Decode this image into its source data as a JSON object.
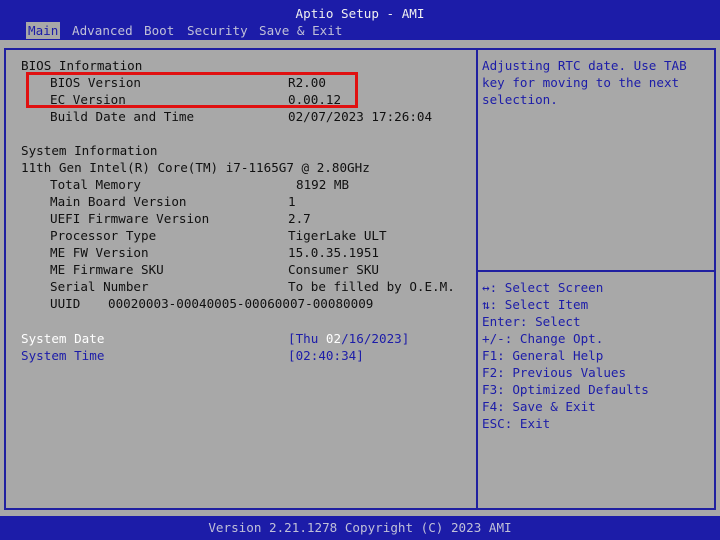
{
  "header": {
    "title": "Aptio Setup - AMI",
    "tabs": [
      "Main",
      "Advanced",
      "Boot",
      "Security",
      "Save & Exit"
    ],
    "active_tab": "Main"
  },
  "main": {
    "bios_info_heading": "BIOS Information",
    "bios_version": {
      "label": "BIOS Version",
      "value": "R2.00"
    },
    "ec_version": {
      "label": "EC Version",
      "value": "0.00.12"
    },
    "build_date": {
      "label": "Build Date and Time",
      "value": "02/07/2023 17:26:04"
    },
    "system_info_heading": "System Information",
    "cpu": "11th Gen Intel(R) Core(TM) i7-1165G7 @ 2.80GHz",
    "total_memory": {
      "label": "Total Memory",
      "value": "8192 MB"
    },
    "main_board_version": {
      "label": "Main Board Version",
      "value": "1"
    },
    "uefi_fw_version": {
      "label": "UEFI Firmware Version",
      "value": "2.7"
    },
    "processor_type": {
      "label": "Processor Type",
      "value": "TigerLake ULT"
    },
    "me_fw_version": {
      "label": "ME FW Version",
      "value": "15.0.35.1951"
    },
    "me_fw_sku": {
      "label": "ME Firmware SKU",
      "value": "Consumer SKU"
    },
    "serial_number": {
      "label": "Serial Number",
      "value": "To be filled by O.E.M."
    },
    "uuid": {
      "label": "UUID",
      "value": "00020003-00040005-00060007-00080009"
    },
    "system_date": {
      "label": "System Date",
      "value_prefix": "[Thu ",
      "value_selected": "02",
      "value_suffix": "/16/2023]"
    },
    "system_time": {
      "label": "System Time",
      "value": "[02:40:34]"
    }
  },
  "help": {
    "line1": "Adjusting RTC date. Use TAB",
    "line2": "key for moving to the next",
    "line3": "selection.",
    "keys": [
      "↔: Select Screen",
      "⇅: Select Item",
      "Enter: Select",
      "+/-: Change Opt.",
      "F1: General Help",
      "F2: Previous Values",
      "F3: Optimized Defaults",
      "F4: Save & Exit",
      "ESC: Exit"
    ]
  },
  "footer": {
    "text": "Version 2.21.1278 Copyright (C) 2023 AMI"
  },
  "colors": {
    "background": "#a8a8a8",
    "bar": "#1c1ca8",
    "highlight_box": "#e01010",
    "selected_text": "#ffffff"
  }
}
